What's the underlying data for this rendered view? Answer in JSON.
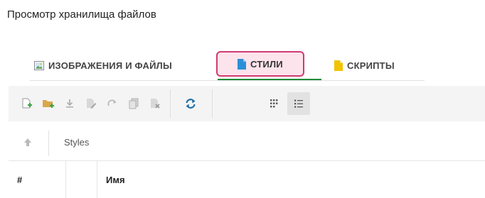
{
  "page": {
    "title": "Просмотр хранилища файлов"
  },
  "tabs": [
    {
      "label": "ИЗОБРАЖЕНИЯ И ФАЙЛЫ",
      "icon": "image-icon"
    },
    {
      "label": "СТИЛИ",
      "icon": "document-icon",
      "active": true
    },
    {
      "label": "СКРИПТЫ",
      "icon": "script-file-icon"
    }
  ],
  "colors": {
    "active_tab_fill": "#fde3ec",
    "active_tab_border": "#d13a72",
    "active_underline": "#1e8a3a",
    "styles_icon": "#2b8fd8",
    "scripts_icon": "#f2c200",
    "refresh_icon": "#1c6fa8"
  },
  "toolbar": {
    "buttons": [
      "new-file-icon",
      "new-folder-icon",
      "download-icon",
      "edit-icon",
      "redo-icon",
      "copy-icon",
      "delete-icon",
      "refresh-icon",
      "grid-view-icon",
      "list-view-icon"
    ],
    "active_view": "list"
  },
  "path": {
    "current": "Styles"
  },
  "table": {
    "columns": [
      "#",
      "",
      "Имя"
    ]
  }
}
